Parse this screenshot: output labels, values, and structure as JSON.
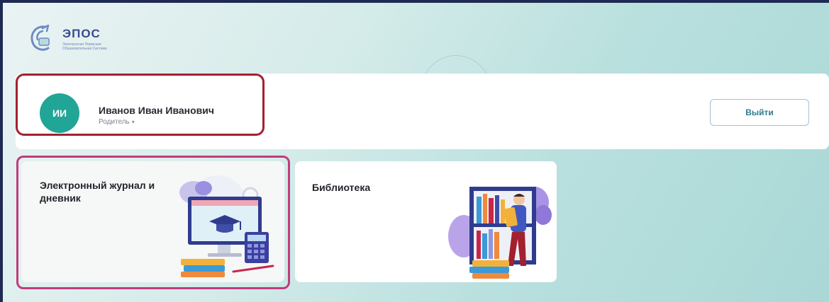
{
  "app": {
    "logo_title": "ЭПОС",
    "logo_subtitle": "Электронная Пермская Образовательная Система"
  },
  "profile": {
    "initials": "ИИ",
    "name": "Иванов Иван Иванович",
    "role": "Родитель",
    "role_chevron": "▾",
    "logout_label": "Выйти"
  },
  "tiles": [
    {
      "title": "Электронный журнал и дневник"
    },
    {
      "title": "Библиотека"
    }
  ],
  "colors": {
    "frame_border": "#1f2a52",
    "avatar": "#21a597",
    "profile_highlight": "#a3202f",
    "tile_highlight": "#c23b7b",
    "button_text": "#2c7d8c"
  },
  "icons": {
    "logo": "epos-logo-icon",
    "journal": "computer-graduation-cap-illustration",
    "library": "bookshelf-person-illustration"
  }
}
